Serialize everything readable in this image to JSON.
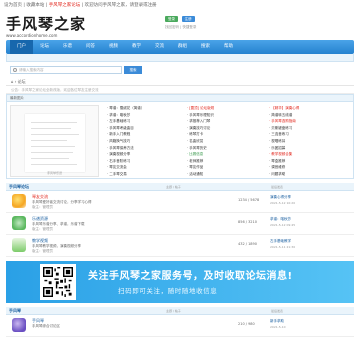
{
  "topbar": {
    "text_a": "设为首页 | 收藏本站 | ",
    "text_red": "手风琴之家论坛",
    "text_b": " | 欢迎访问手风琴之家，请登录或注册"
  },
  "logo": {
    "title": "手风琴之家",
    "url": "www.accordionhome.com"
  },
  "header_buttons": [
    "登录",
    "注册"
  ],
  "header_links": "找回密码 | 快捷登录",
  "nav": [
    "门户",
    "论坛",
    "乐谱",
    "问答",
    "视频",
    "教学",
    "交流",
    "群组",
    "搜索",
    "帮助"
  ],
  "search": {
    "placeholder": "请输入搜索内容",
    "button": "搜索"
  },
  "breadcrumb": "⌂ › 论坛",
  "notice": "公告：手风琴之家论坛全新改版，欢迎各位琴友注册交流",
  "hot": {
    "header": "最新图片",
    "img_caption": "手风琴乐谱",
    "col1": [
      "· 琴谱：雪绒花（简谱）",
      "· 求谱：喀秋莎",
      "· 左手基础练习",
      "· 手风琴考级曲目",
      "· 新手入门教程",
      "· 风箱换气技巧",
      "· 手风琴保养方法",
      "· 演奏视频分享",
      "· 右手音阶练习",
      "· 琴友交流会",
      "· 二手琴交易"
    ],
    "col2": [
      "· [置顶] 论坛版规",
      "· 手风琴乐理知识",
      "· 求推荐入门琴",
      "· 演奏技巧讨论",
      "· 练琴打卡",
      "· 名曲欣赏",
      "· 手风琴历史",
      "· 比赛信息",
      "· 老师推荐",
      "· 琴友作品",
      "· 活动通知"
    ],
    "col3": [
      "· 【精华】演奏心得",
      "· 简谱转五线谱",
      "· 手风琴选购指南",
      "· 贝斯键盘练习",
      "· 三连音练习",
      "· 视唱练耳",
      "· 乐团招募",
      "· 教学视频合集",
      "· 琴盒推荐",
      "· 调音维修",
      "· 问题求助"
    ]
  },
  "section1": {
    "title": "手风琴论坛",
    "sub": "主题 / 帖子",
    "sub2": "最后发表"
  },
  "forums": [
    {
      "name": "琴友交流",
      "desc": "手风琴爱好者交流讨论，分享学习心得",
      "sub": "版主：管理员",
      "stat": "1234 / 5678",
      "last": "演奏心得分享",
      "last_time": "2021-5-12 10:20"
    },
    {
      "name": "乐谱资源",
      "desc": "手风琴乐谱分享、求谱，乐谱下载",
      "sub": "版主：管理员",
      "stat": "856 / 3210",
      "last": "求谱：喀秋莎",
      "last_time": "2021-5-12 09:45"
    },
    {
      "name": "教学视频",
      "desc": "手风琴教学视频，演奏视频分享",
      "sub": "版主：管理员",
      "stat": "432 / 1890",
      "last": "左手基础教学",
      "last_time": "2021-5-11 21:30"
    }
  ],
  "banner": {
    "t1": "关注手风琴之家服务号，及时收取论坛消息!",
    "t2": "扫码即可关注，随时随地收信息"
  },
  "section2": {
    "title": "手风琴",
    "sub": "主题 / 帖子",
    "sub2": "最后发表"
  },
  "forums2": [
    {
      "name": "手风琴",
      "desc": "手风琴综合讨论区",
      "sub": "",
      "stat": "210 / 980",
      "last": "新手求助",
      "last_time": "2021-5-10"
    }
  ]
}
